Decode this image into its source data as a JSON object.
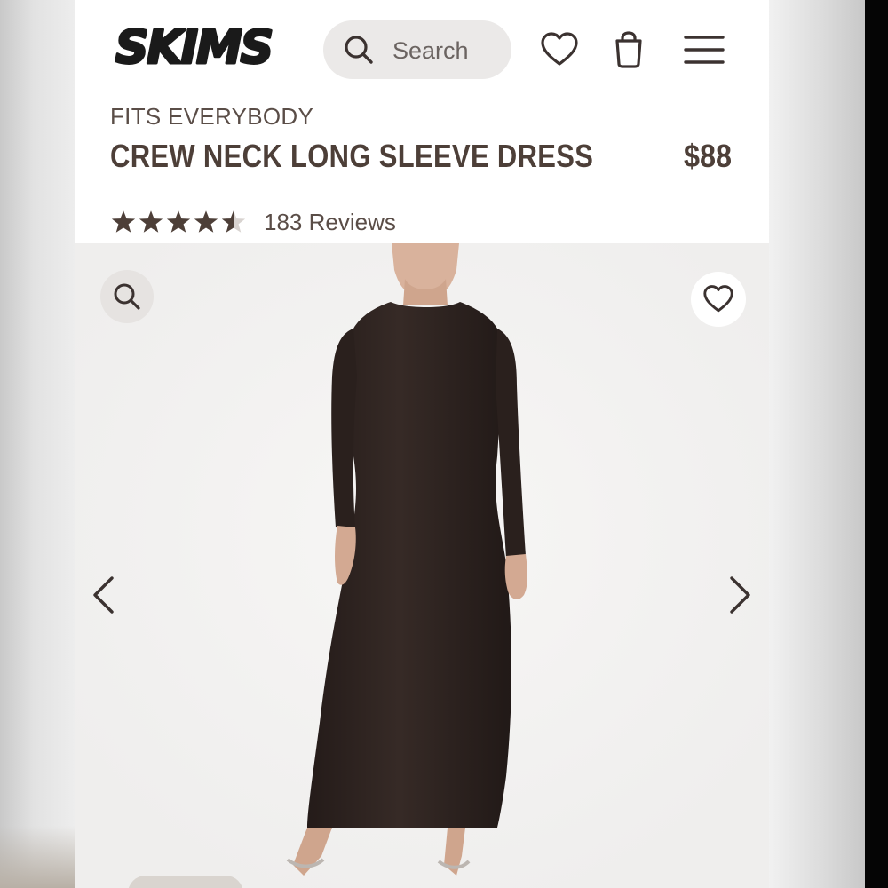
{
  "header": {
    "logo_text": "SKIMS",
    "search_placeholder": "Search",
    "icons": [
      "search-icon",
      "heart-icon",
      "shopping-bag-icon",
      "hamburger-menu-icon"
    ]
  },
  "product": {
    "collection": "FITS EVERYBODY",
    "name": "CREW NECK LONG SLEEVE DRESS",
    "price": "$88",
    "rating": 4.5,
    "reviews_label": "183 Reviews"
  },
  "gallery": {
    "icons": [
      "zoom-icon",
      "heart-icon",
      "chevron-left-icon",
      "chevron-right-icon"
    ]
  },
  "colors": {
    "text_brown": "#4d3f38",
    "dress": "#2e2421",
    "search_bg": "#ebe9e8",
    "image_bg": "#f3f2f1"
  }
}
